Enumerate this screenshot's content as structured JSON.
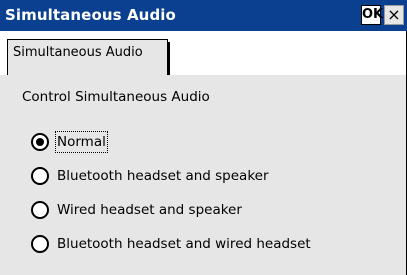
{
  "window": {
    "title": "Simultaneous Audio",
    "ok_label": "OK",
    "close_label": "×",
    "titlebar_color": "#0b3f8f"
  },
  "tabs": [
    {
      "label": "Simultaneous Audio",
      "selected": true
    }
  ],
  "group": {
    "label": "Control Simultaneous Audio",
    "options": [
      {
        "label": "Normal",
        "selected": true
      },
      {
        "label": "Bluetooth headset and speaker",
        "selected": false
      },
      {
        "label": "Wired headset and speaker",
        "selected": false
      },
      {
        "label": "Bluetooth headset and wired headset",
        "selected": false
      }
    ]
  }
}
